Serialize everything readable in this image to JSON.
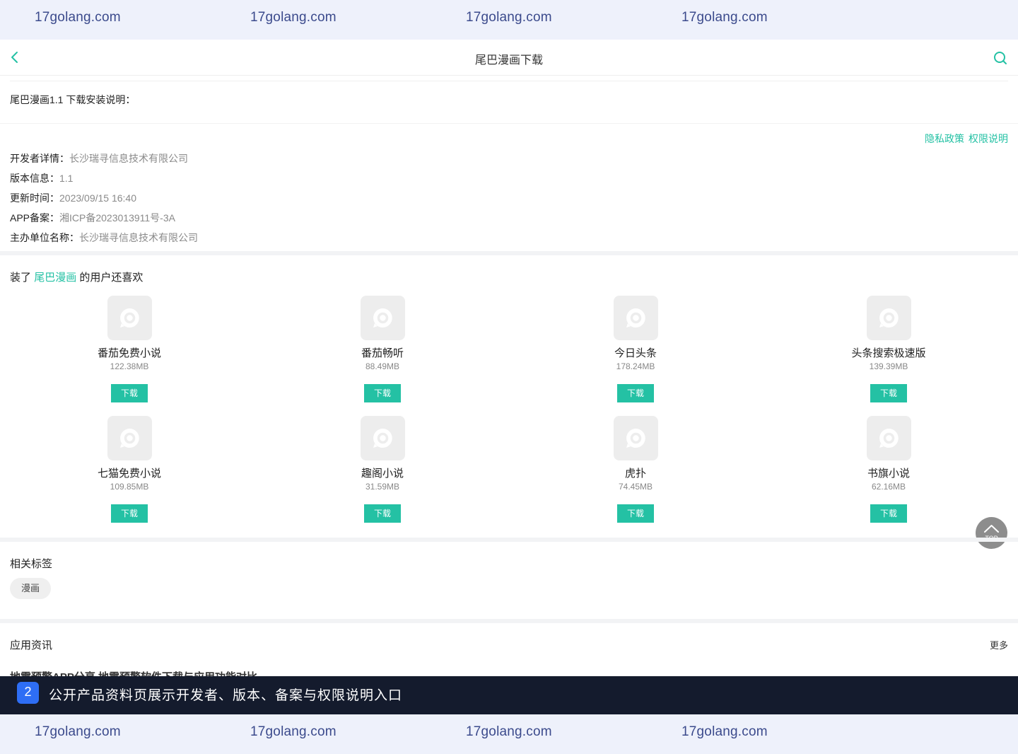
{
  "watermark": {
    "text": "17golang.com"
  },
  "header": {
    "title": "尾巴漫画下载"
  },
  "description": {
    "title": "尾巴漫画1.1 下载安装说明："
  },
  "links": {
    "privacy": "隐私政策",
    "permissions": "权限说明"
  },
  "info": [
    {
      "label": "开发者详情：",
      "value": "长沙瑞寻信息技术有限公司"
    },
    {
      "label": "版本信息：",
      "value": "1.1"
    },
    {
      "label": "更新时间：",
      "value": "2023/09/15 16:40"
    },
    {
      "label": "APP备案：",
      "value": "湘ICP备2023013911号-3A"
    },
    {
      "label": "主办单位名称：",
      "value": "长沙瑞寻信息技术有限公司"
    }
  ],
  "recommend": {
    "prefix": "装了",
    "app": "尾巴漫画",
    "suffix": "的用户还喜欢",
    "download_label": "下载",
    "apps": [
      {
        "name": "番茄免费小说",
        "size": "122.38MB"
      },
      {
        "name": "番茄畅听",
        "size": "88.49MB"
      },
      {
        "name": "今日头条",
        "size": "178.24MB"
      },
      {
        "name": "头条搜索极速版",
        "size": "139.39MB"
      },
      {
        "name": "七猫免费小说",
        "size": "109.85MB"
      },
      {
        "name": "趣阁小说",
        "size": "31.59MB"
      },
      {
        "name": "虎扑",
        "size": "74.45MB"
      },
      {
        "name": "书旗小说",
        "size": "62.16MB"
      }
    ]
  },
  "top_button": {
    "label": "TOP"
  },
  "tags": {
    "title": "相关标签",
    "items": [
      "漫画"
    ]
  },
  "news": {
    "title": "应用资讯",
    "more": "更多",
    "first_item": "地震预警APP分享 地震预警软件下载与应用功能对比"
  },
  "caption": {
    "number": "2",
    "text": "公开产品资料页展示开发者、版本、备案与权限说明入口"
  },
  "colors": {
    "accent": "#24c1a4",
    "caption_bg": "#141b2d",
    "badge": "#2e6ef5",
    "watermark_bg": "#eef1fb"
  }
}
